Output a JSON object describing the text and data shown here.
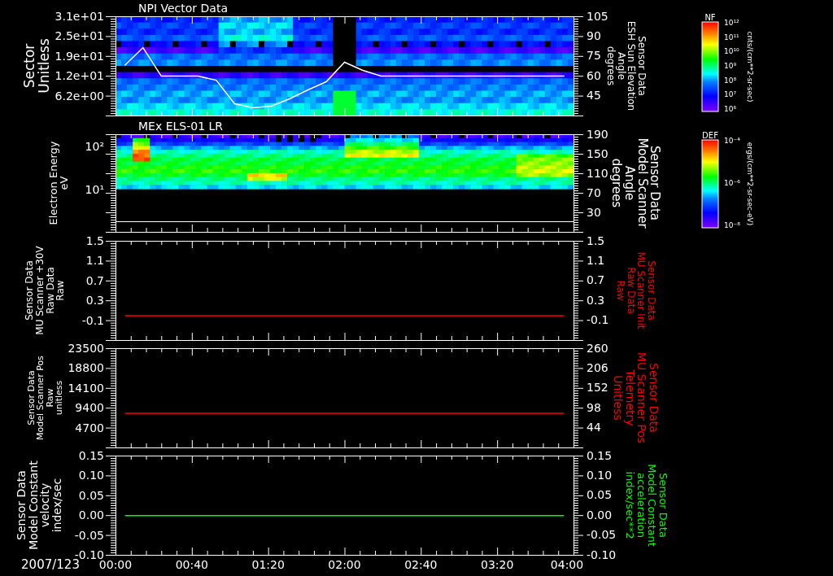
{
  "panels": [
    {
      "kind": "spectrogram",
      "title": "NPI Vector Data",
      "left_axis": {
        "label_lines": [
          "Sector",
          "Unitless"
        ],
        "ticks": [
          "3.1e+01",
          "2.5e+01",
          "1.9e+01",
          "1.2e+01",
          "6.2e+00"
        ]
      },
      "right_axis": {
        "label_lines": [
          "Sensor Data",
          "ESH Sun Elevation",
          "Angle",
          "degrees"
        ],
        "color": "#ffffff"
      },
      "colorbar": {
        "title": "NF",
        "ticks": [
          "10¹²",
          "10¹¹",
          "10¹⁰",
          "10⁹",
          "10⁸",
          "10⁷",
          "10⁶"
        ],
        "units": "cnts/(cm**2-sr-sec)"
      },
      "chart_data": {
        "type": "line",
        "categories": [
          null,
          null,
          null,
          null,
          null,
          null,
          null,
          null,
          null,
          null,
          null,
          null,
          null,
          null,
          null,
          null,
          null,
          null,
          null,
          null,
          null,
          null,
          null,
          null,
          null
        ],
        "ylim": [
          30,
          105
        ],
        "yticks": [
          {
            "value": 105,
            "label": "105"
          },
          {
            "value": 90,
            "label": "90"
          },
          {
            "value": 75,
            "label": "75"
          },
          {
            "value": 60,
            "label": "60"
          },
          {
            "value": 45,
            "label": "45"
          }
        ],
        "series": [
          {
            "color": "#ffffff",
            "values": [
              68.1,
              81.6,
              60.1,
              60.1,
              60.1,
              57.0,
              39.2,
              36.1,
              37.4,
              42.9,
              49.7,
              55.8,
              70.6,
              64.4,
              60.1,
              60.1,
              60.1,
              60.1,
              60.1,
              60.1,
              60.1,
              60.1,
              60.1,
              60.1,
              60.1
            ]
          }
        ]
      }
    },
    {
      "kind": "spectrogram",
      "title": "MEx ELS-01 LR",
      "left_axis": {
        "label_lines": [
          "Electron Energy",
          "eV"
        ],
        "ticks": [
          "10²",
          "10¹"
        ]
      },
      "right_axis": {
        "label_lines": [
          "Sensor Data",
          "Model Scanner",
          "Angle",
          "degrees"
        ],
        "color": "#ffffff",
        "ticks": [
          "190",
          "150",
          "110",
          "70",
          "30"
        ]
      },
      "colorbar": {
        "title": "DEF",
        "ticks": [
          "10⁻⁴",
          "10⁻⁶",
          "10⁻⁸"
        ],
        "units": "ergs/(cm**2-sr-sec-eV)"
      }
    },
    {
      "kind": "line",
      "left_axis": {
        "label_lines": [
          "Sensor Data",
          "MU Scanner +30V",
          "Raw Data",
          "Raw"
        ],
        "ticks": [
          "1.5",
          "1.1",
          "0.7",
          "0.3",
          "-0.1"
        ]
      },
      "right_axis": {
        "label_lines": [
          "Sensor Data",
          "MU Scanner Init",
          "Raw Data",
          "Raw"
        ],
        "color": "#ff0000"
      },
      "chart_data": {
        "type": "line",
        "categories": [
          null,
          null,
          null,
          null,
          null,
          null,
          null,
          null,
          null,
          null,
          null,
          null,
          null,
          null,
          null,
          null,
          null,
          null,
          null,
          null,
          null,
          null,
          null,
          null
        ],
        "ylim": [
          -0.5,
          1.5
        ],
        "yticks": [
          {
            "value": 1.5,
            "label": "1.5"
          },
          {
            "value": 1.1,
            "label": "1.1"
          },
          {
            "value": 0.7,
            "label": "0.7"
          },
          {
            "value": 0.3,
            "label": "0.3"
          },
          {
            "value": -0.1,
            "label": "-0.1"
          }
        ],
        "series": [
          {
            "color": "#ff0000",
            "values": [
              0,
              0,
              0,
              0,
              0,
              0,
              0,
              0,
              0,
              0,
              0,
              0,
              0,
              0,
              0,
              0,
              0,
              0,
              0,
              0,
              0,
              0,
              0,
              0
            ]
          }
        ]
      }
    },
    {
      "kind": "line",
      "left_axis": {
        "label_lines": [
          "Sensor Data",
          "Model Scanner Pos",
          "Raw",
          "unitless"
        ],
        "ticks": [
          "23500",
          "18800",
          "14100",
          "9400",
          "4700"
        ]
      },
      "right_axis": {
        "label_lines": [
          "Sensor Data",
          "MU Scanner Pos",
          "Telemetry",
          "Unitless"
        ],
        "color": "#ff0000"
      },
      "chart_data": {
        "type": "line",
        "categories": [
          null,
          null,
          null,
          null,
          null,
          null,
          null,
          null,
          null,
          null,
          null,
          null,
          null,
          null,
          null,
          null,
          null,
          null,
          null,
          null,
          null,
          null,
          null,
          null
        ],
        "ylim": [
          -10,
          260
        ],
        "yticks": [
          {
            "value": 260,
            "label": "260"
          },
          {
            "value": 206,
            "label": "206"
          },
          {
            "value": 152,
            "label": "152"
          },
          {
            "value": 98,
            "label": "98"
          },
          {
            "value": 44,
            "label": "44"
          }
        ],
        "series": [
          {
            "color": "#ff0000",
            "values": [
              84,
              84,
              84,
              84,
              84,
              84,
              84,
              84,
              84,
              84,
              84,
              84,
              84,
              84,
              84,
              84,
              84,
              84,
              84,
              84,
              84,
              84,
              84,
              84
            ]
          }
        ]
      }
    },
    {
      "kind": "line",
      "left_axis": {
        "label_lines": [
          "Sensor Data",
          "Model Constant",
          "velocity",
          "index/sec"
        ],
        "ticks": [
          "0.15",
          "0.10",
          "0.05",
          "0.00",
          "-0.05",
          "-0.10"
        ]
      },
      "right_axis": {
        "label_lines": [
          "Sensor Data",
          "Model Constant",
          "acceleration",
          "index/sec**2"
        ],
        "color": "#00ff00"
      },
      "chart_data": {
        "type": "line",
        "categories": [
          null,
          null,
          null,
          null,
          null,
          null,
          null,
          null,
          null,
          null,
          null,
          null,
          null,
          null,
          null,
          null,
          null,
          null,
          null,
          null,
          null,
          null,
          null,
          null
        ],
        "ylim": [
          -0.1,
          0.15
        ],
        "yticks": [
          {
            "value": 0.15,
            "label": "0.15"
          },
          {
            "value": 0.1,
            "label": "0.10"
          },
          {
            "value": 0.05,
            "label": "0.05"
          },
          {
            "value": 0,
            "label": "0.00"
          },
          {
            "value": -0.05,
            "label": "-0.05"
          },
          {
            "value": -0.1,
            "label": "-0.10"
          }
        ],
        "series": [
          {
            "color": "#00ff00",
            "values": [
              0,
              0,
              0,
              0,
              0,
              0,
              0,
              0,
              0,
              0,
              0,
              0,
              0,
              0,
              0,
              0,
              0,
              0,
              0,
              0,
              0,
              0,
              0,
              0
            ]
          }
        ]
      }
    }
  ],
  "time_axis": {
    "date": "2007/123",
    "labels": [
      "00:00",
      "00:40",
      "01:20",
      "02:00",
      "02:40",
      "03:20",
      "04:00"
    ]
  }
}
